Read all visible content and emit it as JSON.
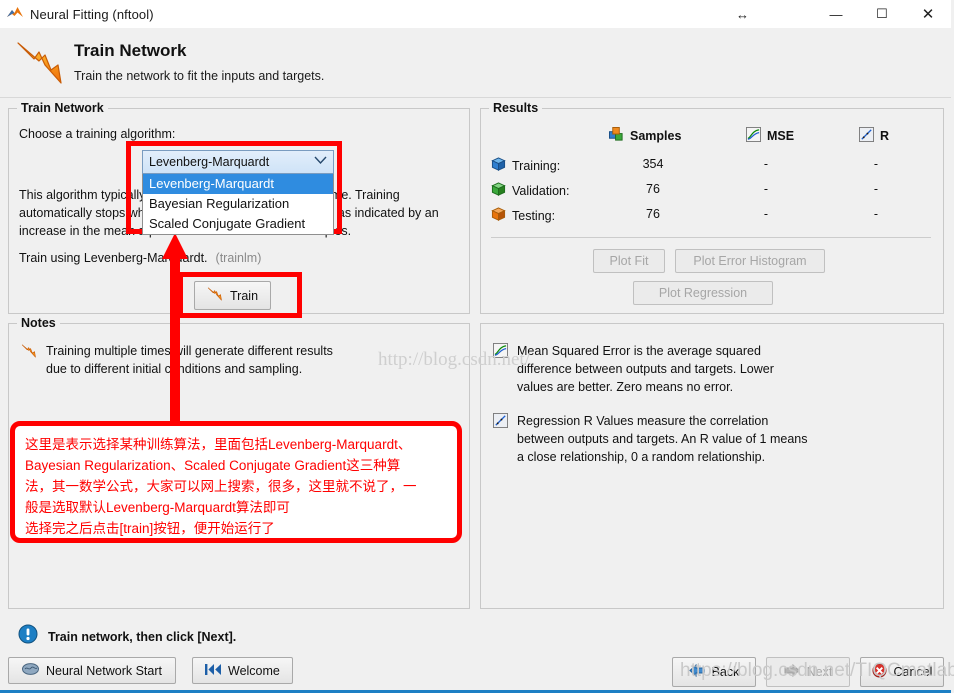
{
  "window": {
    "title": "Neural Fitting (nftool)",
    "icon": "matlab-nn-icon",
    "resize_glyph": "↔",
    "minimize": "—",
    "maximize": "☐",
    "close": "✕"
  },
  "header": {
    "icon": "orange-arrow-icon",
    "title": "Train Network",
    "subtitle": "Train the network to fit the inputs and targets."
  },
  "train_panel": {
    "group_title": "Train Network",
    "choose_label": "Choose a training algorithm:",
    "description": "This algorithm typically requires more memory but less time. Training automatically stops when generalization stops improving, as indicated by an increase in the mean square error of the validation samples.",
    "train_using_prefix": "Train using Levenberg-Marquardt.",
    "train_using_fn": "(trainlm)",
    "train_button": "Train",
    "train_button_icon": "orange-arrow-icon",
    "combo": {
      "selected": "Levenberg-Marquardt",
      "arrow_icon": "chevron-down-icon",
      "options": [
        "Levenberg-Marquardt",
        "Bayesian Regularization",
        "Scaled Conjugate Gradient"
      ],
      "selected_index": 0
    }
  },
  "results_panel": {
    "group_title": "Results",
    "columns": [
      {
        "label": "Samples",
        "icon": "cubes-icon"
      },
      {
        "label": "MSE",
        "icon": "plot-icon"
      },
      {
        "label": "R",
        "icon": "regression-icon"
      }
    ],
    "rows": [
      {
        "label": "Training:",
        "icon": "blue-cube-icon",
        "samples": "354",
        "mse": "-",
        "r": "-"
      },
      {
        "label": "Validation:",
        "icon": "green-cube-icon",
        "samples": "76",
        "mse": "-",
        "r": "-"
      },
      {
        "label": "Testing:",
        "icon": "orange-cube-icon",
        "samples": "76",
        "mse": "-",
        "r": "-"
      }
    ],
    "buttons": [
      {
        "label": "Plot Fit",
        "enabled": false
      },
      {
        "label": "Plot Error Histogram",
        "enabled": false
      },
      {
        "label": "Plot Regression",
        "enabled": false
      }
    ]
  },
  "notes_left": {
    "group_title": "Notes",
    "items": [
      {
        "icon": "orange-arrow-icon",
        "lines": [
          "Training multiple times will generate different results",
          "due to different initial conditions and sampling."
        ]
      }
    ]
  },
  "notes_right": {
    "items": [
      {
        "icon": "plot-icon",
        "lines": [
          "Mean Squared Error is the average squared",
          "difference between outputs and targets. Lower",
          "values are better. Zero means no error."
        ]
      },
      {
        "icon": "regression-icon",
        "lines": [
          "Regression R Values measure the correlation",
          "between outputs and targets. An R value of 1 means",
          "a close relationship, 0 a random relationship."
        ]
      }
    ]
  },
  "annotation": {
    "lines": [
      "这里是表示选择某种训练算法，里面包括Levenberg-Marquardt、",
      "Bayesian Regularization、Scaled Conjugate Gradient这三种算",
      "法，其一数学公式，大家可以网上搜索，很多，这里就不说了，一",
      "般是选取默认Levenberg-Marquardt算法即可",
      "选择完之后点击[train]按钮，便开始运行了"
    ],
    "color": "#ff0000"
  },
  "watermarks": {
    "center": "http://blog.csdn.net/",
    "bottom": "https://blog.csdn.net/TIQCmatlab"
  },
  "statusbar": {
    "icon": "info-icon",
    "message": "Train network, then click [Next].",
    "left_buttons": [
      {
        "label": "Neural Network Start",
        "icon": "brain-icon",
        "enabled": true
      },
      {
        "label": "Welcome",
        "icon": "rewind-icon",
        "enabled": true
      }
    ],
    "right_buttons": [
      {
        "label": "Back",
        "icon": "arrow-left-icon",
        "enabled": true
      },
      {
        "label": "Next",
        "icon": "arrow-right-icon",
        "enabled": false
      },
      {
        "label": "Cancel",
        "icon": "cancel-icon",
        "enabled": true
      }
    ]
  },
  "colors": {
    "panel_bg": "#f0f0f0",
    "accent_blue": "#1d7fc4",
    "annotation_red": "#ff0000",
    "highlight_blue": "#2f8ce0"
  }
}
